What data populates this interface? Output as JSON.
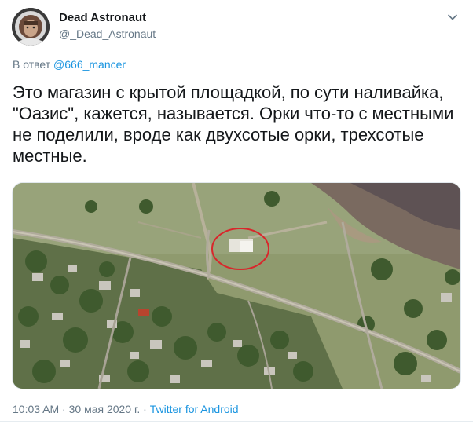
{
  "author": {
    "display_name": "Dead Astronaut",
    "handle": "@_Dead_Astronaut"
  },
  "reply": {
    "prefix": "В ответ ",
    "mention": "@666_mancer"
  },
  "tweet": {
    "text": "Это магазин с крытой площадкой, по сути наливайка, \"Оазис\", кажется, называется. Орки что-то с местными не поделили, вроде как двухсотые орки, трехсотые местные."
  },
  "media": {
    "icon": "satellite-map-image",
    "highlight_color": "#d9262b"
  },
  "meta": {
    "time": "10:03 AM",
    "separator1": " · ",
    "date": "30 мая 2020 г.",
    "separator2": " · ",
    "source": "Twitter for Android"
  },
  "colors": {
    "link": "#1b95e0",
    "secondary": "#657786",
    "text": "#14171a"
  }
}
